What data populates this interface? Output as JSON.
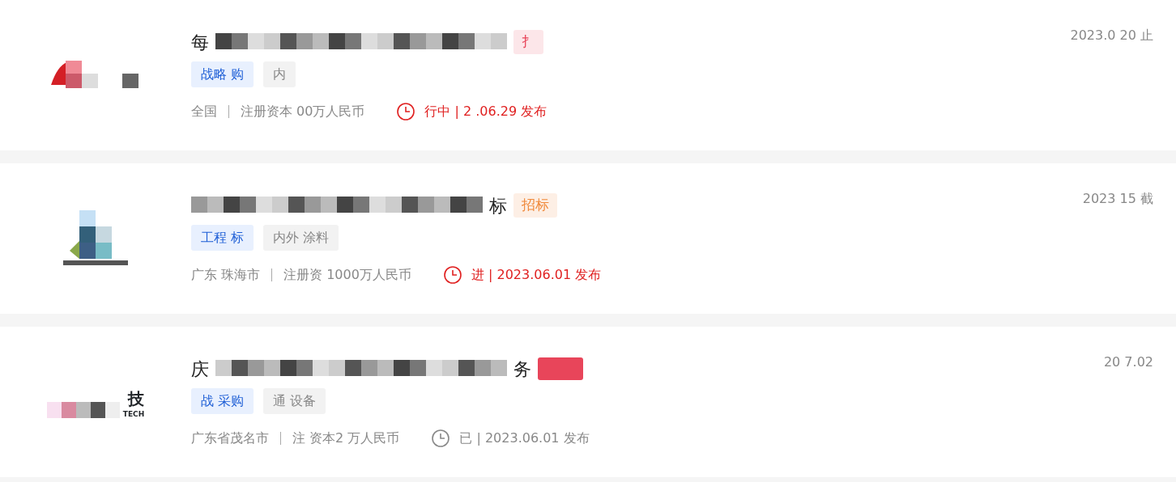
{
  "listings": [
    {
      "logo": {
        "kind": "red"
      },
      "title_start": "每",
      "bid_tag": {
        "text": "扌",
        "color": "#e8455a"
      },
      "tags": [
        "战略 购",
        "内"
      ],
      "region": "全国",
      "capital": "注册资本 00万人民币",
      "status": {
        "kind": "ongoing",
        "text": "行中 | 2 .06.29 发布"
      },
      "deadline": "2023.0 20 止"
    },
    {
      "logo": {
        "kind": "blocks"
      },
      "title_end": "标",
      "bid_tag": {
        "text": "招标",
        "color": "#f08a3c"
      },
      "tags": [
        "工程 标",
        "内外 涂料"
      ],
      "region": "广东 珠海市",
      "capital": "注册资 1000万人民币",
      "status": {
        "kind": "ongoing",
        "text": "进 | 2023.06.01 发布"
      },
      "deadline": "2023 15 截"
    },
    {
      "logo": {
        "kind": "tech",
        "word": "技",
        "sub": "TECH"
      },
      "title_start": "庆",
      "title_end": "务",
      "bid_tag": {
        "color": "#e8455a"
      },
      "tags": [
        "战 采购",
        "通 设备"
      ],
      "region": "广东省茂名市",
      "capital": "注 资本2 万人民币",
      "status": {
        "kind": "ended",
        "text": "已 | 2023.06.01 发布"
      },
      "deadline": "20 7.02"
    }
  ]
}
